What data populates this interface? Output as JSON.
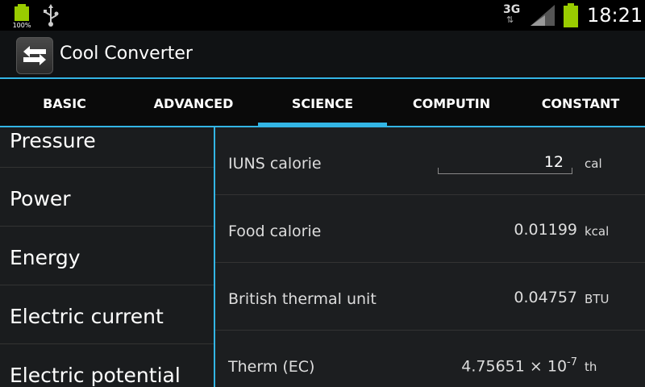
{
  "status": {
    "battery_percent_label": "100%",
    "network_type": "3G",
    "time": "18:21"
  },
  "app": {
    "title": "Cool Converter",
    "icon": "swap-arrows-icon"
  },
  "tabs": [
    {
      "label": "BASIC",
      "active": false
    },
    {
      "label": "ADVANCED",
      "active": false
    },
    {
      "label": "SCIENCE",
      "active": true
    },
    {
      "label": "COMPUTIN",
      "active": false
    },
    {
      "label": "CONSTANT",
      "active": false
    }
  ],
  "categories": [
    {
      "label": "Pressure"
    },
    {
      "label": "Power"
    },
    {
      "label": "Energy"
    },
    {
      "label": "Electric current"
    },
    {
      "label": "Electric potential"
    }
  ],
  "units": [
    {
      "name": "IUNS calorie",
      "value": "12",
      "unit": "cal",
      "editable": true
    },
    {
      "name": "Food calorie",
      "value": "0.01199",
      "unit": "kcal"
    },
    {
      "name": "British thermal unit",
      "value": "0.04757",
      "unit": "BTU"
    },
    {
      "name": "Therm (EC)",
      "value_mantissa": "4.75651 × 10",
      "value_exponent": "-7",
      "unit": "th"
    }
  ],
  "colors": {
    "accent": "#33b5e5",
    "battery": "#99cc00"
  }
}
